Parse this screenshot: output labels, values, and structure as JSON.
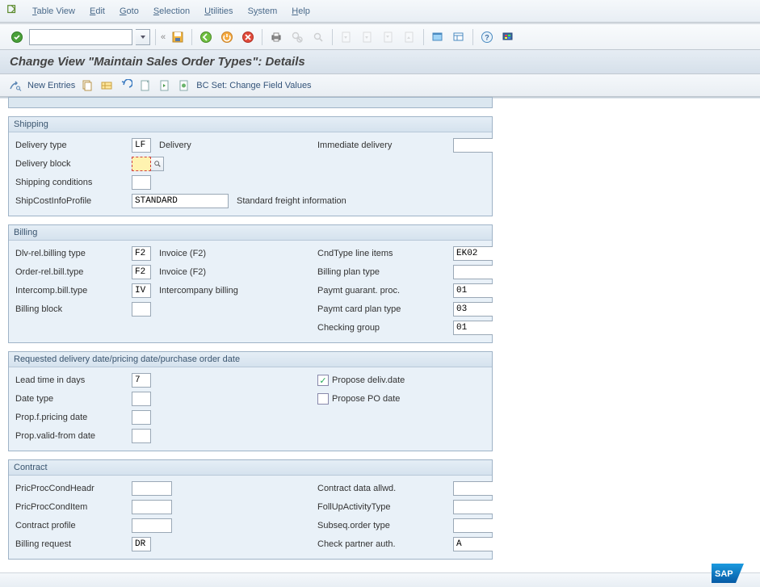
{
  "menu": {
    "table_view": "Table View",
    "edit": "Edit",
    "goto": "Goto",
    "selection": "Selection",
    "utilities": "Utilities",
    "system": "System",
    "help": "Help"
  },
  "title": "Change View \"Maintain Sales Order Types\": Details",
  "apptb": {
    "new_entries": "New Entries",
    "bc_set": "BC Set: Change Field Values"
  },
  "shipping": {
    "header": "Shipping",
    "delivery_type_l": "Delivery type",
    "delivery_type_v": "LF",
    "delivery_type_d": "Delivery",
    "immediate_delivery_l": "Immediate delivery",
    "delivery_block_l": "Delivery block",
    "shipping_cond_l": "Shipping conditions",
    "shipcost_l": "ShipCostInfoProfile",
    "shipcost_v": "STANDARD",
    "shipcost_d": "Standard freight information"
  },
  "billing": {
    "header": "Billing",
    "dlv_rel_l": "Dlv-rel.billing type",
    "dlv_rel_v": "F2",
    "dlv_rel_d": "Invoice (F2)",
    "order_rel_l": "Order-rel.bill.type",
    "order_rel_v": "F2",
    "order_rel_d": "Invoice (F2)",
    "intercomp_l": "Intercomp.bill.type",
    "intercomp_v": "IV",
    "intercomp_d": "Intercompany billing",
    "billing_block_l": "Billing block",
    "cndtype_l": "CndType line items",
    "cndtype_v": "EK02",
    "billplan_l": "Billing plan type",
    "paymt_guar_l": "Paymt guarant. proc.",
    "paymt_guar_v": "01",
    "paymt_card_l": "Paymt card plan type",
    "paymt_card_v": "03",
    "checking_group_l": "Checking group",
    "checking_group_v": "01"
  },
  "dates": {
    "header": "Requested delivery date/pricing date/purchase order date",
    "lead_l": "Lead time in days",
    "lead_v": "7",
    "date_type_l": "Date type",
    "prop_pricing_l": "Prop.f.pricing date",
    "prop_valid_l": "Prop.valid-from date",
    "propose_deliv_l": "Propose deliv.date",
    "propose_po_l": "Propose PO date"
  },
  "contract": {
    "header": "Contract",
    "pph_l": "PricProcCondHeadr",
    "ppi_l": "PricProcCondItem",
    "profile_l": "Contract profile",
    "billreq_l": "Billing request",
    "billreq_v": "DR",
    "contract_data_l": "Contract data allwd.",
    "follup_l": "FollUpActivityType",
    "subseq_l": "Subseq.order type",
    "checkpartner_l": "Check partner auth.",
    "checkpartner_v": "A"
  }
}
